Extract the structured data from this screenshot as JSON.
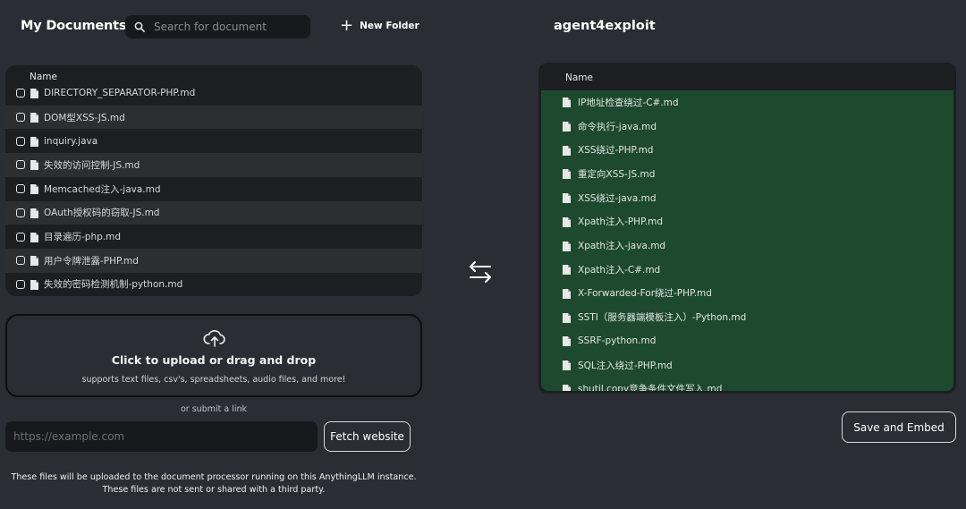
{
  "left_panel": {
    "title": "My Documents",
    "search_placeholder": "Search for document",
    "new_folder_label": "New Folder",
    "column_header": "Name",
    "files": [
      "DIRECTORY_SEPARATOR-PHP.md",
      "DOM型XSS-JS.md",
      "inquiry.java",
      "失效的访问控制-JS.md",
      "Memcached注入-java.md",
      "OAuth授权码的窃取-JS.md",
      "目录遍历-php.md",
      "用户令牌泄露-PHP.md",
      "失效的密码检测机制-python.md"
    ]
  },
  "upload": {
    "title": "Click to upload or drag and drop",
    "subtitle": "supports text files, csv's, spreadsheets, audio files, and more!",
    "or_link": "or submit a link",
    "url_placeholder": "https://example.com",
    "fetch_label": "Fetch website",
    "note_line1": "These files will be uploaded to the document processor running on this AnythingLLM instance.",
    "note_line2": "These files are not sent or shared with a third party."
  },
  "workspace": {
    "title": "agent4exploit",
    "column_header": "Name",
    "files": [
      "IP地址检查绕过-C#.md",
      "命令执行-java.md",
      "XSS绕过-PHP.md",
      "重定向XSS-JS.md",
      "XSS绕过-java.md",
      "Xpath注入-PHP.md",
      "Xpath注入-java.md",
      "Xpath注入-C#.md",
      "X-Forwarded-For绕过-PHP.md",
      "SSTI（服务器端模板注入）-Python.md",
      "SSRF-python.md",
      "SQL注入绕过-PHP.md",
      "shutil.copy竞争条件文件写入.md"
    ],
    "save_label": "Save and Embed"
  },
  "colors": {
    "background": "#2a2d33",
    "panel": "#1d1e21",
    "workspace_green": "#1d4a2e"
  }
}
